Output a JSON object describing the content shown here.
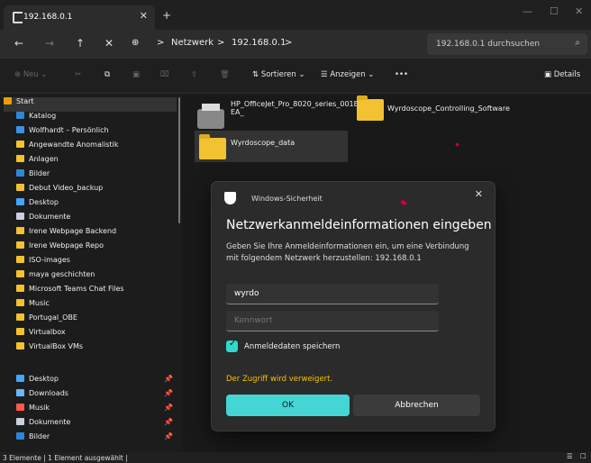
{
  "window": {
    "tab_title": "192.168.0.1",
    "tab_close": "✕",
    "new_tab": "+",
    "minimize": "—",
    "maximize": "☐",
    "close": "✕"
  },
  "navigation": {
    "back": "←",
    "forward": "→",
    "up": "↑",
    "refresh": "✕",
    "breadcrumb": [
      "Netzwerk",
      "192.168.0.1"
    ],
    "separator": ">",
    "search_placeholder": "192.168.0.1 durchsuchen",
    "search_icon": "⌕"
  },
  "toolbar": {
    "new": "⊕ Neu ⌄",
    "cut": "✂",
    "copy": "⧉",
    "paste": "▣",
    "rename": "⌧",
    "share": "⇪",
    "delete": "🗑",
    "sort": "⇅ Sortieren ⌄",
    "view": "☰ Anzeigen ⌄",
    "more": "•••",
    "details": "▣ Details"
  },
  "sidebar": {
    "items": [
      {
        "label": "Start",
        "icon": "home-icon"
      },
      {
        "label": "Katalog",
        "icon": "image-icon"
      },
      {
        "label": "Wolfhardt – Persönlich",
        "icon": "cloud-icon"
      },
      {
        "label": "Angewandte Anomalistik",
        "icon": "folder-icon"
      },
      {
        "label": "Anlagen",
        "icon": "folder-icon"
      },
      {
        "label": "Bilder",
        "icon": "image-icon"
      },
      {
        "label": "Debut Video_backup",
        "icon": "folder-icon"
      },
      {
        "label": "Desktop",
        "icon": "desktop-icon"
      },
      {
        "label": "Dokumente",
        "icon": "document-icon"
      },
      {
        "label": "Irene Webpage Backend",
        "icon": "folder-icon"
      },
      {
        "label": "Irene Webpage Repo",
        "icon": "folder-icon"
      },
      {
        "label": "ISO-images",
        "icon": "folder-icon"
      },
      {
        "label": "maya geschichten",
        "icon": "folder-icon"
      },
      {
        "label": "Microsoft Teams Chat Files",
        "icon": "folder-icon"
      },
      {
        "label": "Music",
        "icon": "folder-icon"
      },
      {
        "label": "Portugal_OBE",
        "icon": "folder-icon"
      },
      {
        "label": "Virtualbox",
        "icon": "folder-icon"
      },
      {
        "label": "VirtualBox VMs",
        "icon": "folder-icon"
      },
      {
        "label": "Desktop",
        "icon": "desktop-icon"
      },
      {
        "label": "Downloads",
        "icon": "download-icon"
      },
      {
        "label": "Musik",
        "icon": "music-icon"
      },
      {
        "label": "Dokumente",
        "icon": "document-icon"
      },
      {
        "label": "Bilder",
        "icon": "image-icon"
      }
    ],
    "pin": "📌"
  },
  "files": {
    "printer": "HP_OfficeJet_Pro_8020_series_001E\nEA_",
    "folder_1": "Wyrdoscope_Controlling_Software",
    "folder_2": "Wyrdoscope_data"
  },
  "dialog": {
    "title": "Windows-Sicherheit",
    "close": "✕",
    "heading": "Netzwerkanmeldeinformationen eingeben",
    "message": "Geben Sie Ihre Anmeldeinformationen ein, um eine Verbindung mit folgendem Netzwerk herzustellen: 192.168.0.1",
    "username": "wyrdo",
    "password_placeholder": "Kennwort",
    "remember": "Anmeldedaten speichern",
    "error": "Der Zugriff wird verweigert.",
    "ok": "OK",
    "cancel": "Abbrechen",
    "checkmark": "✓"
  },
  "status": {
    "text": "3 Elemente  |  1 Element ausgewählt  |",
    "details_view": "☰",
    "tiles_view": "☐"
  },
  "colors": {
    "accent": "#45d5d4",
    "folder": "#f2c230",
    "error": "#f3c400",
    "background": "#191919"
  }
}
